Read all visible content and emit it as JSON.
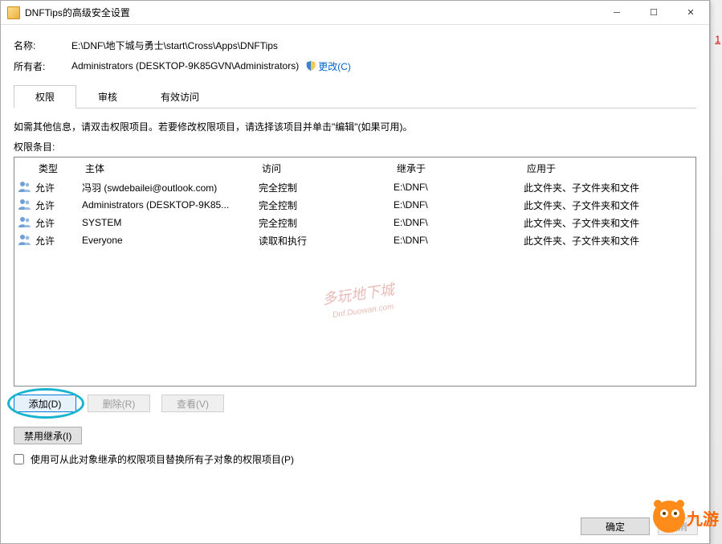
{
  "window": {
    "title": "DNFTips的高级安全设置"
  },
  "info": {
    "name_label": "名称:",
    "name_value": "E:\\DNF\\地下城与勇士\\start\\Cross\\Apps\\DNFTips",
    "owner_label": "所有者:",
    "owner_value": "Administrators (DESKTOP-9K85GVN\\Administrators)",
    "change_link": "更改(C)"
  },
  "tabs": {
    "perm": "权限",
    "audit": "审核",
    "effective": "有效访问"
  },
  "instruction": "如需其他信息，请双击权限项目。若要修改权限项目，请选择该项目并单击\"编辑\"(如果可用)。",
  "list_label": "权限条目:",
  "headers": {
    "type": "类型",
    "principal": "主体",
    "access": "访问",
    "inherited": "继承于",
    "applies": "应用于"
  },
  "rows": [
    {
      "type": "允许",
      "principal": "冯羽 (swdebailei@outlook.com)",
      "access": "完全控制",
      "inherited": "E:\\DNF\\",
      "applies": "此文件夹、子文件夹和文件"
    },
    {
      "type": "允许",
      "principal": "Administrators (DESKTOP-9K85...",
      "access": "完全控制",
      "inherited": "E:\\DNF\\",
      "applies": "此文件夹、子文件夹和文件"
    },
    {
      "type": "允许",
      "principal": "SYSTEM",
      "access": "完全控制",
      "inherited": "E:\\DNF\\",
      "applies": "此文件夹、子文件夹和文件"
    },
    {
      "type": "允许",
      "principal": "Everyone",
      "access": "读取和执行",
      "inherited": "E:\\DNF\\",
      "applies": "此文件夹、子文件夹和文件"
    }
  ],
  "buttons": {
    "add": "添加(D)",
    "remove": "删除(R)",
    "view": "查看(V)",
    "disable_inh": "禁用继承(I)",
    "ok": "确定",
    "cancel": "取消"
  },
  "replace_label": "使用可从此对象继承的权限项目替换所有子对象的权限项目(P)",
  "side_num": "1"
}
